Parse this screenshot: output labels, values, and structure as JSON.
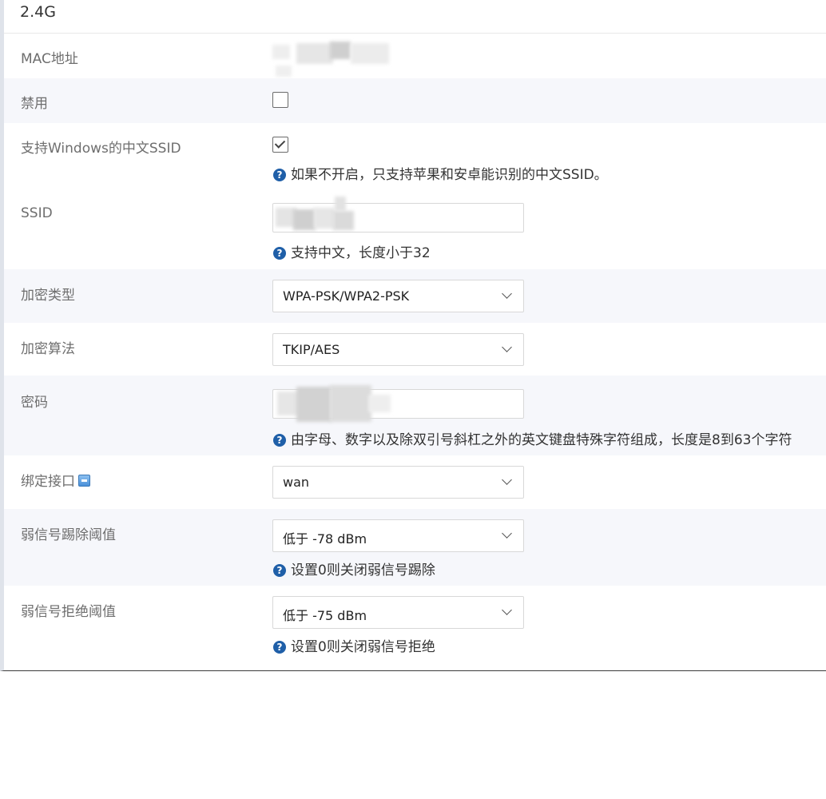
{
  "section": {
    "title": "2.4G"
  },
  "fields": {
    "mac": {
      "label": "MAC地址"
    },
    "disable": {
      "label": "禁用",
      "checked": false
    },
    "windows_ssid": {
      "label": "支持Windows的中文SSID",
      "checked": true,
      "hint": "如果不开启，只支持苹果和安卓能识别的中文SSID。"
    },
    "ssid": {
      "label": "SSID",
      "hint": "支持中文，长度小于32"
    },
    "encryption_type": {
      "label": "加密类型",
      "value": "WPA-PSK/WPA2-PSK"
    },
    "encryption_algorithm": {
      "label": "加密算法",
      "value": "TKIP/AES"
    },
    "password": {
      "label": "密码",
      "hint": "由字母、数字以及除双引号斜杠之外的英文键盘特殊字符组成，长度是8到63个字符"
    },
    "bind_interface": {
      "label": "绑定接口",
      "value": "wan"
    },
    "weak_kick": {
      "label": "弱信号踢除阈值",
      "value": "低于 -78 dBm",
      "hint": "设置0则关闭弱信号踢除"
    },
    "weak_reject": {
      "label": "弱信号拒绝阈值",
      "value": "低于 -75 dBm",
      "hint": "设置0则关闭弱信号拒绝"
    }
  },
  "icons": {
    "help": "question-circle-icon",
    "bind_interface": "port-icon",
    "dropdown": "chevron-down-icon"
  },
  "colors": {
    "row_shade": "#f6f7fb",
    "help_icon": "#1f5fa8",
    "label_text": "#6e6e6e"
  }
}
